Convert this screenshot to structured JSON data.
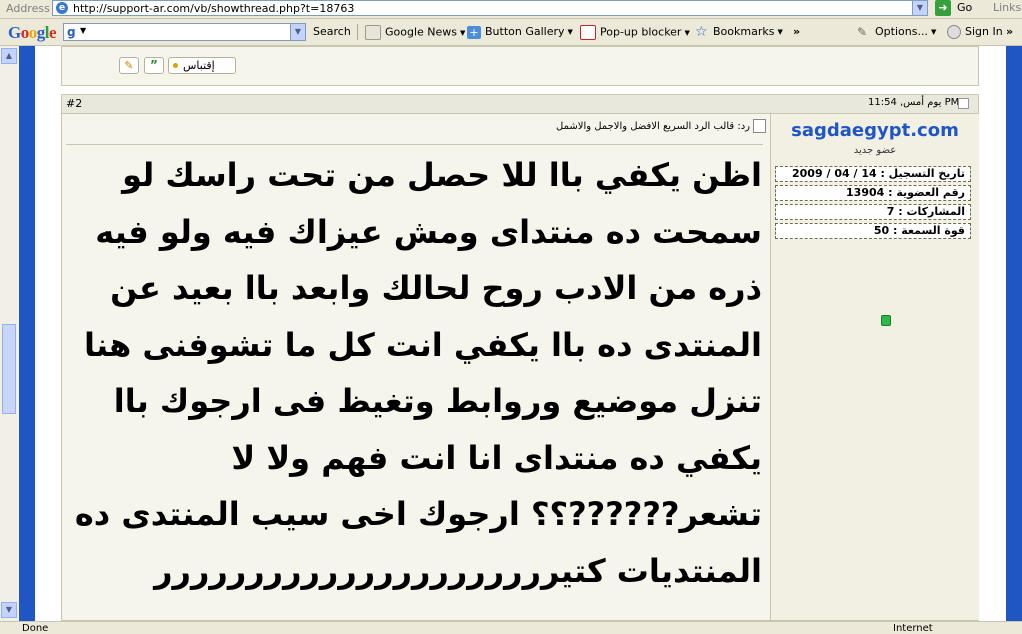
{
  "browser": {
    "address_label": "Address",
    "url": "http://support-ar.com/vb/showthread.php?t=18763",
    "go_label": "Go",
    "links_label": "Links"
  },
  "google_toolbar": {
    "logo": [
      "G",
      "o",
      "o",
      "g",
      "l",
      "e"
    ],
    "search_g": "g",
    "items": [
      {
        "label": "Search",
        "icon": "search-icon"
      },
      {
        "label": "Google News",
        "icon": "news-icon"
      },
      {
        "label": "Button Gallery",
        "icon": "plus-icon"
      },
      {
        "label": "Pop-up blocker",
        "icon": "popup-blocker-icon"
      },
      {
        "label": "Bookmarks",
        "icon": "star-icon"
      },
      {
        "label": "Options...",
        "icon": "wrench-icon"
      },
      {
        "label": "Sign In",
        "icon": "user-icon"
      }
    ],
    "more": "»",
    "colors": {
      "blue": "#2a5fc9",
      "red": "#d62c1f",
      "yellow": "#e8a90c",
      "green": "#2e9b3c"
    }
  },
  "prev_post": {
    "quote_label": "إقتباس"
  },
  "post": {
    "number": "#2",
    "date": "يوم أمس, 11:54 PM",
    "title": "رد: قالب الرد السريع الافضل والاجمل والاشمل",
    "user": {
      "name": "sagdaegypt.com",
      "title": "عضو جديد",
      "join_date": "تاريخ التسجيل : 14 / 04 / 2009",
      "member_no": "رقم العضوية : 13904",
      "posts": "المشاركات : 7",
      "reputation": "قوة السمعة : 50"
    },
    "body_lines": [
      "اظن يكفي باا للا حصل من تحت راسك لو",
      "سمحت ده منتداى ومش عيزاك فيه ولو فيه",
      "ذره من الادب روح لحالك وابعد باا بعيد عن",
      "المنتدى ده باا يكفي انت كل ما تشوفنى هنا",
      "تنزل موضيع وروابط وتغيظ فى ارجوك باا",
      "يكفي ده منتداى انا انت فهم ولا لا",
      "تشعر??????؟؟ ارجوك اخى سيب المنتدى ده",
      "المنتديات كتيرررررررررررررررررررررر"
    ]
  },
  "status_bar": {
    "left": "Done",
    "zone": "Internet"
  },
  "colors": {
    "frame_blue": "#1f56c4",
    "post_bg": "#f5f5ec",
    "username": "#1f56c4"
  }
}
